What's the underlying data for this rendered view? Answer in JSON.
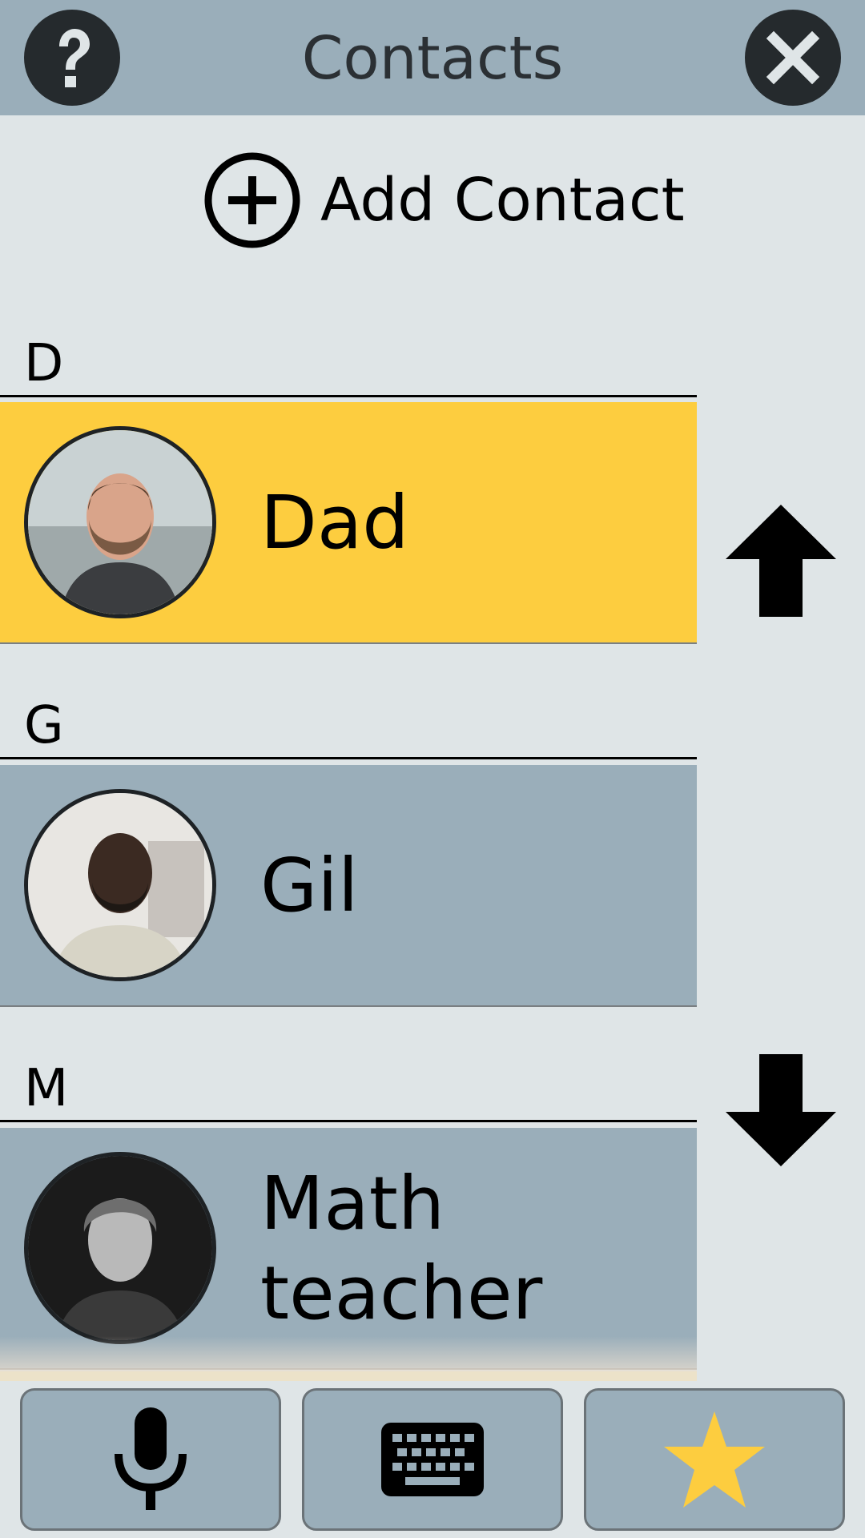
{
  "header": {
    "title": "Contacts",
    "help_icon": "question-mark-icon",
    "close_icon": "close-x-icon"
  },
  "add_contact": {
    "label": "Add Contact",
    "icon": "plus-circle-icon"
  },
  "sections": [
    {
      "letter": "D",
      "contacts": [
        {
          "name": "Dad",
          "highlighted": true,
          "avatar": "bearded-man-photo"
        }
      ]
    },
    {
      "letter": "G",
      "contacts": [
        {
          "name": "Gil",
          "highlighted": false,
          "avatar": "smiling-man-photo"
        }
      ]
    },
    {
      "letter": "M",
      "contacts": [
        {
          "name": "Math teacher",
          "highlighted": false,
          "avatar": "curly-haired-man-photo"
        }
      ]
    }
  ],
  "scroll": {
    "up_icon": "arrow-up-icon",
    "down_icon": "arrow-down-icon"
  },
  "toolbar": {
    "mic_icon": "microphone-icon",
    "keyboard_icon": "keyboard-icon",
    "favorites_icon": "star-icon"
  },
  "colors": {
    "header_bg": "#9aaeba",
    "page_bg": "#dfe5e7",
    "highlight": "#fdcd3f",
    "row_bg": "#9aaeba",
    "icon_dark": "#252a2d",
    "star": "#fdcd3f"
  }
}
